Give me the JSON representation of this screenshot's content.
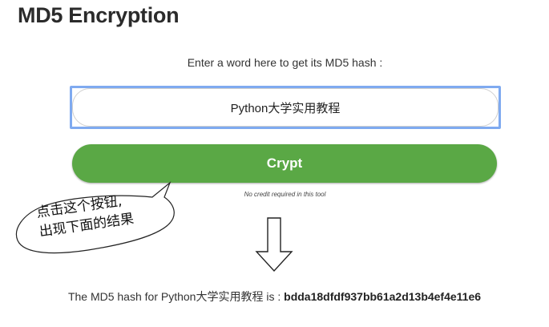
{
  "title": "MD5 Encryption",
  "form": {
    "prompt": "Enter a word here to get its MD5 hash :",
    "input_value": "Python大学实用教程",
    "button_label": "Crypt",
    "credit_note": "No credit required in this tool"
  },
  "annotation": {
    "line1": "点击这个按钮,",
    "line2": "出现下面的结果"
  },
  "result": {
    "prefix": "The MD5 hash for Python大学实用教程 is :",
    "hash": "bdda18dfdf937bb61a2d13b4ef4e11e6"
  },
  "colors": {
    "button": "#5aa845",
    "input_focus_border": "#7faaf0"
  },
  "icons": {
    "arrow": "down-arrow-icon"
  }
}
